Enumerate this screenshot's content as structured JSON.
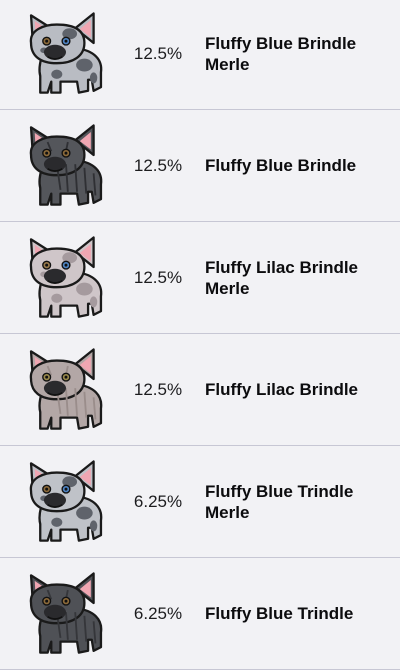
{
  "rows": [
    {
      "percent": "12.5%",
      "name": "Fluffy Blue Brindle Merle",
      "coat": "#b9bcc3",
      "spots": "#5f636b",
      "stripes": "",
      "eyeL": "#8c6a3a",
      "eyeR": "#4f84c4"
    },
    {
      "percent": "12.5%",
      "name": "Fluffy Blue Brindle",
      "coat": "#54565b",
      "spots": "",
      "stripes": "#2f3034",
      "eyeL": "#8c6a3a",
      "eyeR": "#8c6a3a"
    },
    {
      "percent": "12.5%",
      "name": "Fluffy Lilac Brindle Merle",
      "coat": "#cfc6c9",
      "spots": "#a59a9e",
      "stripes": "",
      "eyeL": "#9a7b4c",
      "eyeR": "#4f84c4"
    },
    {
      "percent": "12.5%",
      "name": "Fluffy Lilac Brindle",
      "coat": "#b3a7a6",
      "spots": "",
      "stripes": "#9a8d8b",
      "eyeL": "#9a8a4c",
      "eyeR": "#9a8a4c"
    },
    {
      "percent": "6.25%",
      "name": "Fluffy Blue Trindle Merle",
      "coat": "#bfc2c8",
      "spots": "#5f636b",
      "stripes": "",
      "eyeL": "#8c6a3a",
      "eyeR": "#4f84c4"
    },
    {
      "percent": "6.25%",
      "name": "Fluffy Blue Trindle",
      "coat": "#4f5156",
      "spots": "",
      "stripes": "#35363a",
      "eyeL": "#8c6a3a",
      "eyeR": "#8c6a3a"
    }
  ]
}
